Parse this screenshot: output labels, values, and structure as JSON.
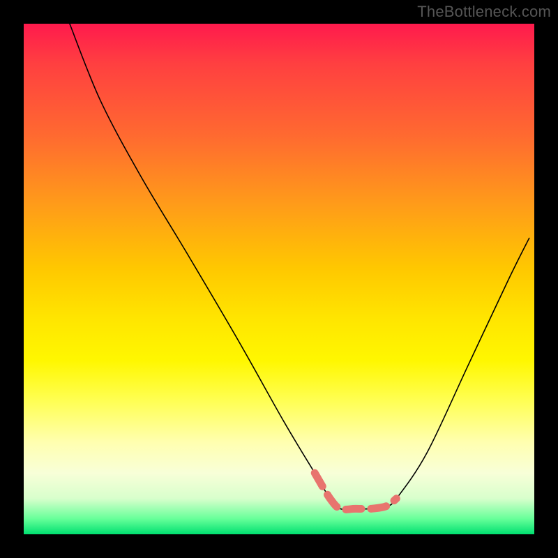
{
  "watermark": "TheBottleneck.com",
  "chart_data": {
    "type": "line",
    "title": "",
    "xlabel": "",
    "ylabel": "",
    "xlim": [
      0,
      100
    ],
    "ylim": [
      0,
      100
    ],
    "grid": false,
    "series": [
      {
        "name": "curve",
        "x": [
          9,
          15,
          23,
          32,
          42,
          51,
          57,
          60,
          62,
          65,
          68,
          71,
          73,
          79,
          87,
          95,
          99
        ],
        "y": [
          100,
          85,
          70,
          55,
          38,
          22,
          12,
          7,
          5,
          5,
          5,
          5.5,
          7,
          16,
          33,
          50,
          58
        ]
      },
      {
        "name": "highlight-segments",
        "style": "thick-pink",
        "x": [
          57,
          60,
          62,
          65,
          68,
          71,
          73
        ],
        "y": [
          12,
          7,
          5,
          5,
          5,
          5.5,
          7
        ]
      }
    ],
    "annotations": []
  },
  "colors": {
    "background": "#000000",
    "curve": "#000000",
    "highlight": "#e8746e"
  }
}
